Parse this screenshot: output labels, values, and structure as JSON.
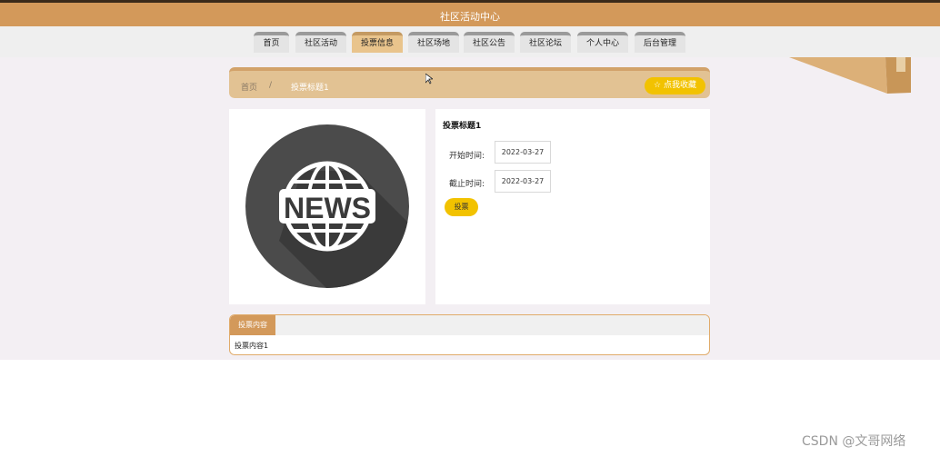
{
  "header": {
    "title": "社区活动中心"
  },
  "nav": {
    "items": [
      {
        "label": "首页",
        "name": "nav-home"
      },
      {
        "label": "社区活动",
        "name": "nav-activities"
      },
      {
        "label": "投票信息",
        "name": "nav-vote-info"
      },
      {
        "label": "社区场地",
        "name": "nav-venues"
      },
      {
        "label": "社区公告",
        "name": "nav-announcements"
      },
      {
        "label": "社区论坛",
        "name": "nav-forum"
      },
      {
        "label": "个人中心",
        "name": "nav-profile"
      },
      {
        "label": "后台管理",
        "name": "nav-admin"
      }
    ],
    "active": "投票信息"
  },
  "breadcrumb": {
    "home": "首页",
    "separator": "/",
    "current": "投票标题1"
  },
  "favorite_button": "☆ 点我收藏",
  "image": {
    "icon": "news-globe-icon",
    "text": "NEWS"
  },
  "detail": {
    "title": "投票标题1",
    "start_label": "开始时间:",
    "start_value": "2022-03-27",
    "end_label": "截止时间:",
    "end_value": "2022-03-27",
    "vote_button": "投票"
  },
  "content": {
    "tab_label": "投票内容",
    "text": "投票内容1"
  },
  "watermark": "CSDN @文哥网络",
  "colors": {
    "accent": "#d3995a",
    "button_yellow": "#f2c200",
    "breadcrumb_bg": "#e2c293"
  }
}
